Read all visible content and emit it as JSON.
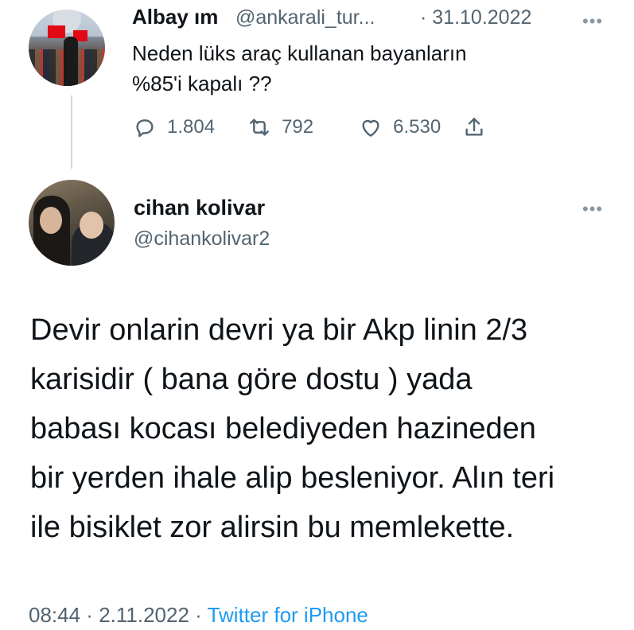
{
  "original_tweet": {
    "display_name": "Albay ım",
    "handle": "@ankarali_tur...",
    "date": "· 31.10.2022",
    "more": "•••",
    "text": "Neden lüks araç kullanan bayanların\n%85'i kapalı ??",
    "actions": {
      "replies": "1.804",
      "retweets": "792",
      "likes": "6.530"
    },
    "icons": [
      "reply-icon",
      "retweet-icon",
      "like-icon",
      "share-icon"
    ]
  },
  "reply_tweet": {
    "display_name": "cihan kolivar",
    "handle": "@cihankolivar2",
    "more": "•••",
    "text": "Devir onlarin devri ya bir Akp linin 2/3\nkarisidir ( bana göre dostu ) yada\nbabası kocası belediyeden hazineden\nbir yerden ihale alip besleniyor. Alın teri\nile bisiklet zor alirsin bu memlekette.",
    "footer": {
      "time": "08:44",
      "sep1": " · ",
      "date": "2.11.2022",
      "sep2": " · ",
      "source": "Twitter for iPhone"
    }
  },
  "colors": {
    "text": "#0f1419",
    "secondary": "#536471",
    "link": "#1d9bf0",
    "thread_line": "#cfd9de"
  }
}
